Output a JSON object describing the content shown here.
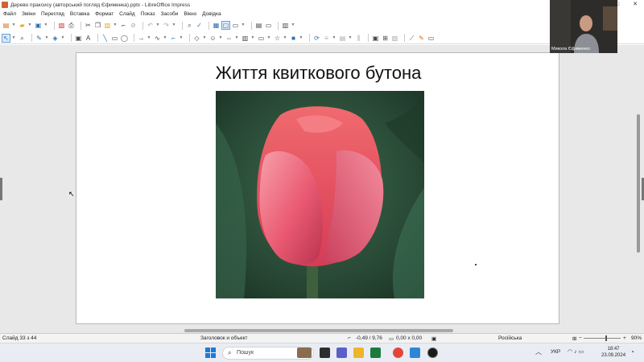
{
  "window": {
    "title": "Дерево праксису (авторський погляд Єфименка).pptx - LibreOffice Impress",
    "min_label": "—",
    "max_label": "□",
    "close_label": "✕"
  },
  "menu": [
    "Файл",
    "Зміни",
    "Перегляд",
    "Вставка",
    "Формат",
    "Слайд",
    "Показ",
    "Засоби",
    "Вікно",
    "Довідка"
  ],
  "slide": {
    "title": "Життя квиткового бутона"
  },
  "video": {
    "participant_name": "Микола Єфименко"
  },
  "status": {
    "slide_info": "Слайд 33 з 44",
    "selection": "Заголовок и объект",
    "position": "-0,49 / 9,76",
    "size": "0,00 x 0,00",
    "language": "Російська",
    "zoom": "90%",
    "zoom_level_percent": 60
  },
  "taskbar": {
    "search_placeholder": "Пошук",
    "language": "УКР",
    "time": "18:47",
    "date": "23.09.2024"
  },
  "icons": {
    "cursor": "arrow-pointer-icon",
    "search": "search-icon"
  },
  "colors": {
    "accent": "#2a6fb5",
    "slide_bg": "#ffffff",
    "workspace_bg": "#e8e8e8"
  }
}
